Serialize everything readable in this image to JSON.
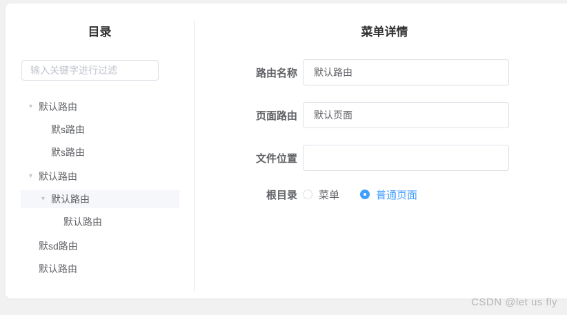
{
  "colors": {
    "accent": "#409eff",
    "selected_row_bg": "#f5f7fa",
    "input_border": "#dcdfe6",
    "text": "#606266",
    "page_bg": "#f1f1f2"
  },
  "left_panel": {
    "title": "目录",
    "search": {
      "placeholder": "输入关键字进行过滤",
      "value": ""
    },
    "tree": {
      "items": [
        {
          "label": "默认路由",
          "level": 0,
          "expanded": true,
          "selected": false
        },
        {
          "label": "默s路由",
          "level": 1,
          "expanded": false,
          "selected": false
        },
        {
          "label": "默s路由",
          "level": 1,
          "expanded": false,
          "selected": false
        },
        {
          "label": "默认路由",
          "level": 0,
          "expanded": true,
          "selected": false
        },
        {
          "label": "默认路由",
          "level": 1,
          "expanded": true,
          "selected": true
        },
        {
          "label": "默认路由",
          "level": 2,
          "expanded": false,
          "selected": false
        },
        {
          "label": "默sd路由",
          "level": 0,
          "expanded": false,
          "selected": false
        },
        {
          "label": "默认路由",
          "level": 0,
          "expanded": false,
          "selected": false
        }
      ]
    }
  },
  "right_panel": {
    "title": "菜单详情",
    "form": {
      "fields": [
        {
          "label": "路由名称",
          "value": "默认路由"
        },
        {
          "label": "页面路由",
          "value": "默认页面"
        },
        {
          "label": "文件位置",
          "value": ""
        }
      ],
      "radio_group": {
        "label": "根目录",
        "options": [
          {
            "label": "菜单",
            "checked": false
          },
          {
            "label": "普通页面",
            "checked": true
          }
        ]
      }
    }
  },
  "page": {
    "watermark": "CSDN @let us fly"
  }
}
